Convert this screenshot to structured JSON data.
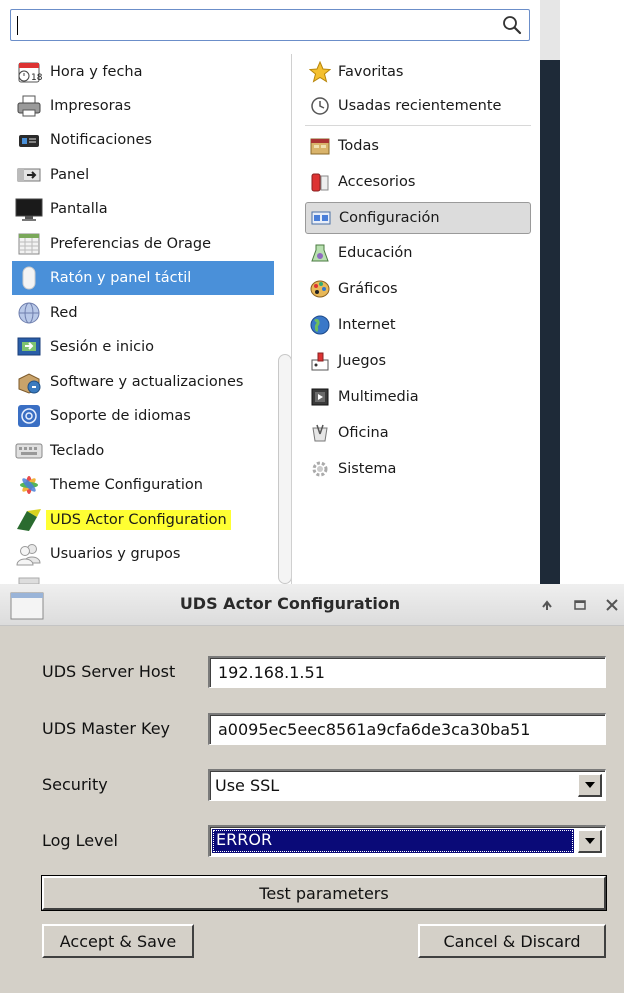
{
  "menu": {
    "search": {
      "value": "",
      "placeholder": ""
    },
    "apps": [
      {
        "label": "Hora y fecha",
        "icon": "calendar-icon"
      },
      {
        "label": "Impresoras",
        "icon": "printer-icon"
      },
      {
        "label": "Notificaciones",
        "icon": "notification-icon"
      },
      {
        "label": "Panel",
        "icon": "panel-icon"
      },
      {
        "label": "Pantalla",
        "icon": "monitor-icon"
      },
      {
        "label": "Preferencias de Orage",
        "icon": "orage-calendar-icon"
      },
      {
        "label": "Ratón y panel táctil",
        "icon": "mouse-icon",
        "selected": true
      },
      {
        "label": "Red",
        "icon": "network-globe-icon"
      },
      {
        "label": "Sesión e inicio",
        "icon": "session-icon"
      },
      {
        "label": "Software y actualizaciones",
        "icon": "software-update-icon"
      },
      {
        "label": "Soporte de idiomas",
        "icon": "language-icon"
      },
      {
        "label": "Teclado",
        "icon": "keyboard-icon"
      },
      {
        "label": "Theme Configuration",
        "icon": "theme-icon"
      },
      {
        "label": "UDS Actor Configuration",
        "icon": "uds-actor-icon",
        "highlighted": true
      },
      {
        "label": "Usuarios y grupos",
        "icon": "users-icon"
      }
    ],
    "categories": [
      {
        "label": "Favoritas",
        "icon": "star-icon"
      },
      {
        "label": "Usadas recientemente",
        "icon": "history-icon"
      },
      {
        "label": "Todas",
        "icon": "folder-icon"
      },
      {
        "label": "Accesorios",
        "icon": "accessories-icon"
      },
      {
        "label": "Configuración",
        "icon": "settings-icon",
        "selected": true
      },
      {
        "label": "Educación",
        "icon": "education-icon"
      },
      {
        "label": "Gráficos",
        "icon": "graphics-icon"
      },
      {
        "label": "Internet",
        "icon": "internet-globe-icon"
      },
      {
        "label": "Juegos",
        "icon": "games-icon"
      },
      {
        "label": "Multimedia",
        "icon": "multimedia-icon"
      },
      {
        "label": "Oficina",
        "icon": "office-icon"
      },
      {
        "label": "Sistema",
        "icon": "system-gear-icon"
      }
    ]
  },
  "dialog": {
    "title": "UDS Actor Configuration",
    "fields": {
      "host_label": "UDS Server Host",
      "host_value": "192.168.1.51",
      "key_label": "UDS Master Key",
      "key_value": "a0095ec5eec8561a9cfa6de3ca30ba51",
      "security_label": "Security",
      "security_value": "Use SSL",
      "log_label": "Log Level",
      "log_value": "ERROR"
    },
    "buttons": {
      "test": "Test parameters",
      "accept": "Accept & Save",
      "cancel": "Cancel & Discard"
    }
  },
  "colors": {
    "selection": "#4a90d9",
    "highlight": "#ffff33",
    "dialog_bg": "#d4d0c8",
    "combo_focus": "#0a0a78"
  }
}
